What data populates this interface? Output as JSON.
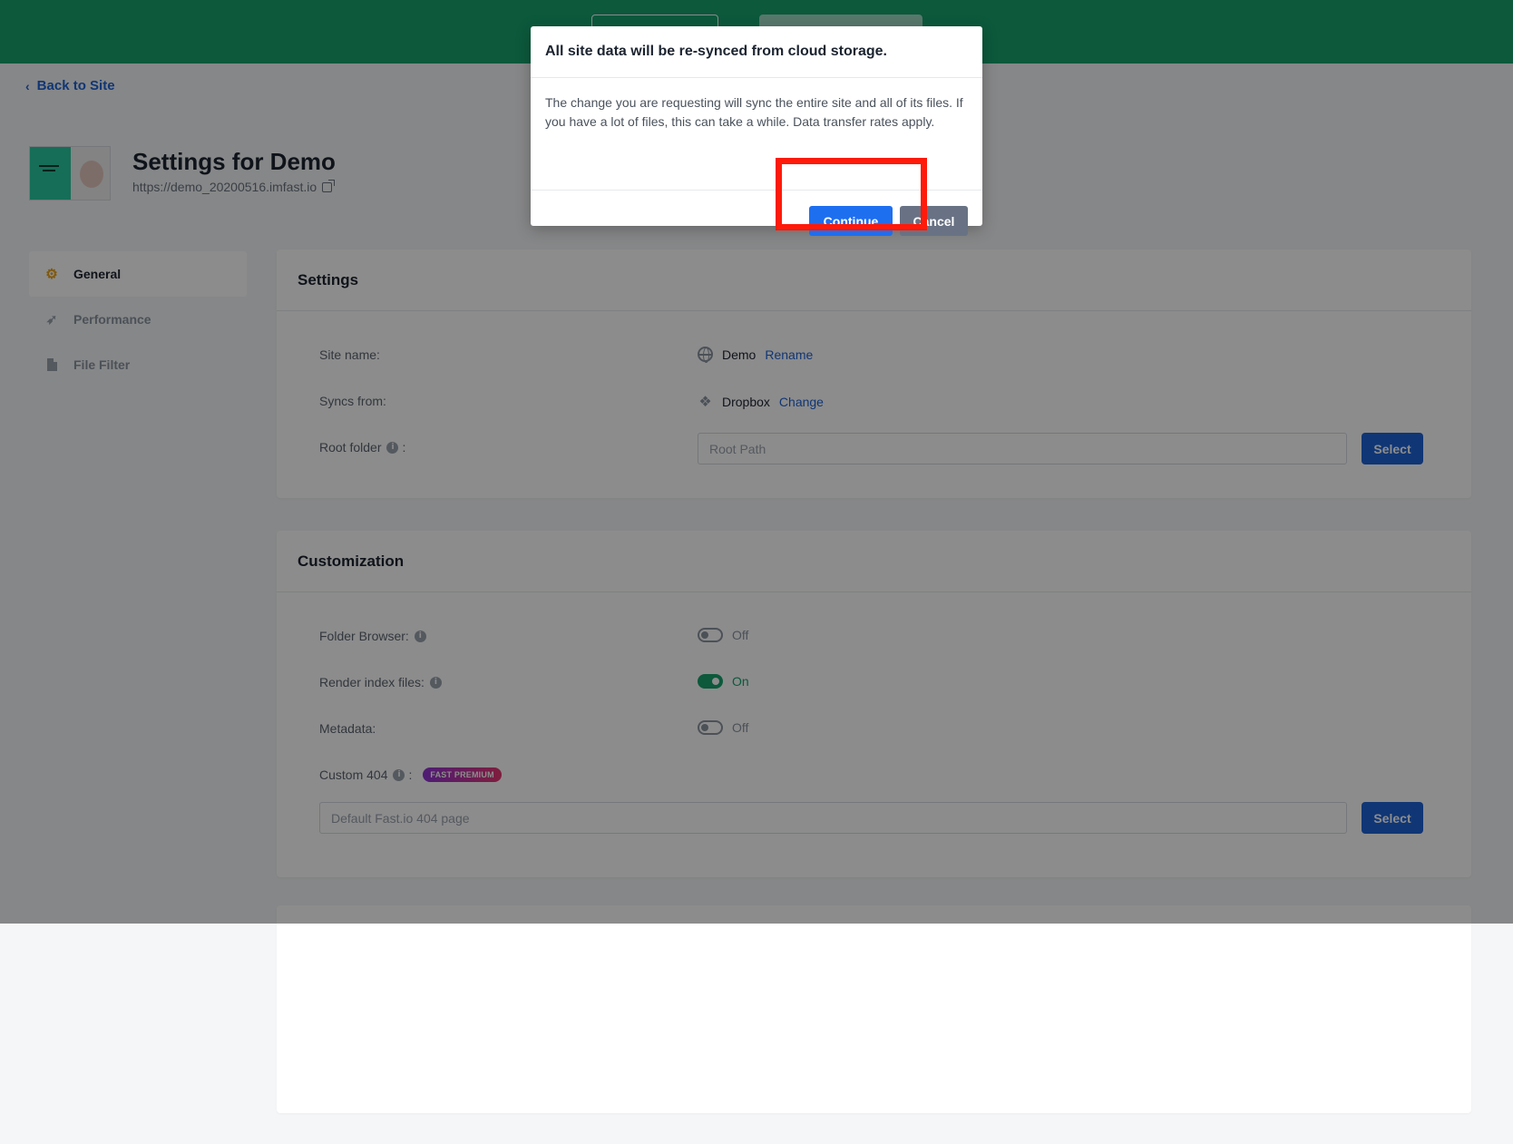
{
  "back": {
    "label": "Back to Site"
  },
  "site": {
    "title": "Settings for Demo",
    "url": "https://demo_20200516.imfast.io"
  },
  "nav": {
    "items": [
      {
        "label": "General",
        "icon": "gear-icon",
        "active": true
      },
      {
        "label": "Performance",
        "icon": "rocket-icon",
        "active": false
      },
      {
        "label": "File Filter",
        "icon": "file-icon",
        "active": false
      }
    ]
  },
  "settings": {
    "heading": "Settings",
    "site_name_label": "Site name:",
    "site_name_value": "Demo",
    "rename_label": "Rename",
    "syncs_from_label": "Syncs from:",
    "syncs_from_value": "Dropbox",
    "change_label": "Change",
    "root_folder_label": "Root folder",
    "root_folder_colon": ":",
    "root_path_placeholder": "Root Path",
    "select_label": "Select"
  },
  "customization": {
    "heading": "Customization",
    "folder_browser_label": "Folder Browser:",
    "folder_browser_state": "Off",
    "render_index_label": "Render index files:",
    "render_index_state": "On",
    "metadata_label": "Metadata:",
    "metadata_state": "Off",
    "custom404_label": "Custom 404",
    "custom404_colon": ":",
    "premium_badge": "FAST PREMIUM",
    "custom404_placeholder": "Default Fast.io 404 page",
    "select_label": "Select"
  },
  "modal": {
    "title": "All site data will be re-synced from cloud storage.",
    "body": "The change you are requesting will sync the entire site and all of its files. If you have a lot of files, this can take a while. Data transfer rates apply.",
    "continue_label": "Continue",
    "cancel_label": "Cancel"
  },
  "colors": {
    "brand_green": "#16a36e",
    "primary_blue": "#1e63d6",
    "highlight_red": "#ff1a0a"
  }
}
